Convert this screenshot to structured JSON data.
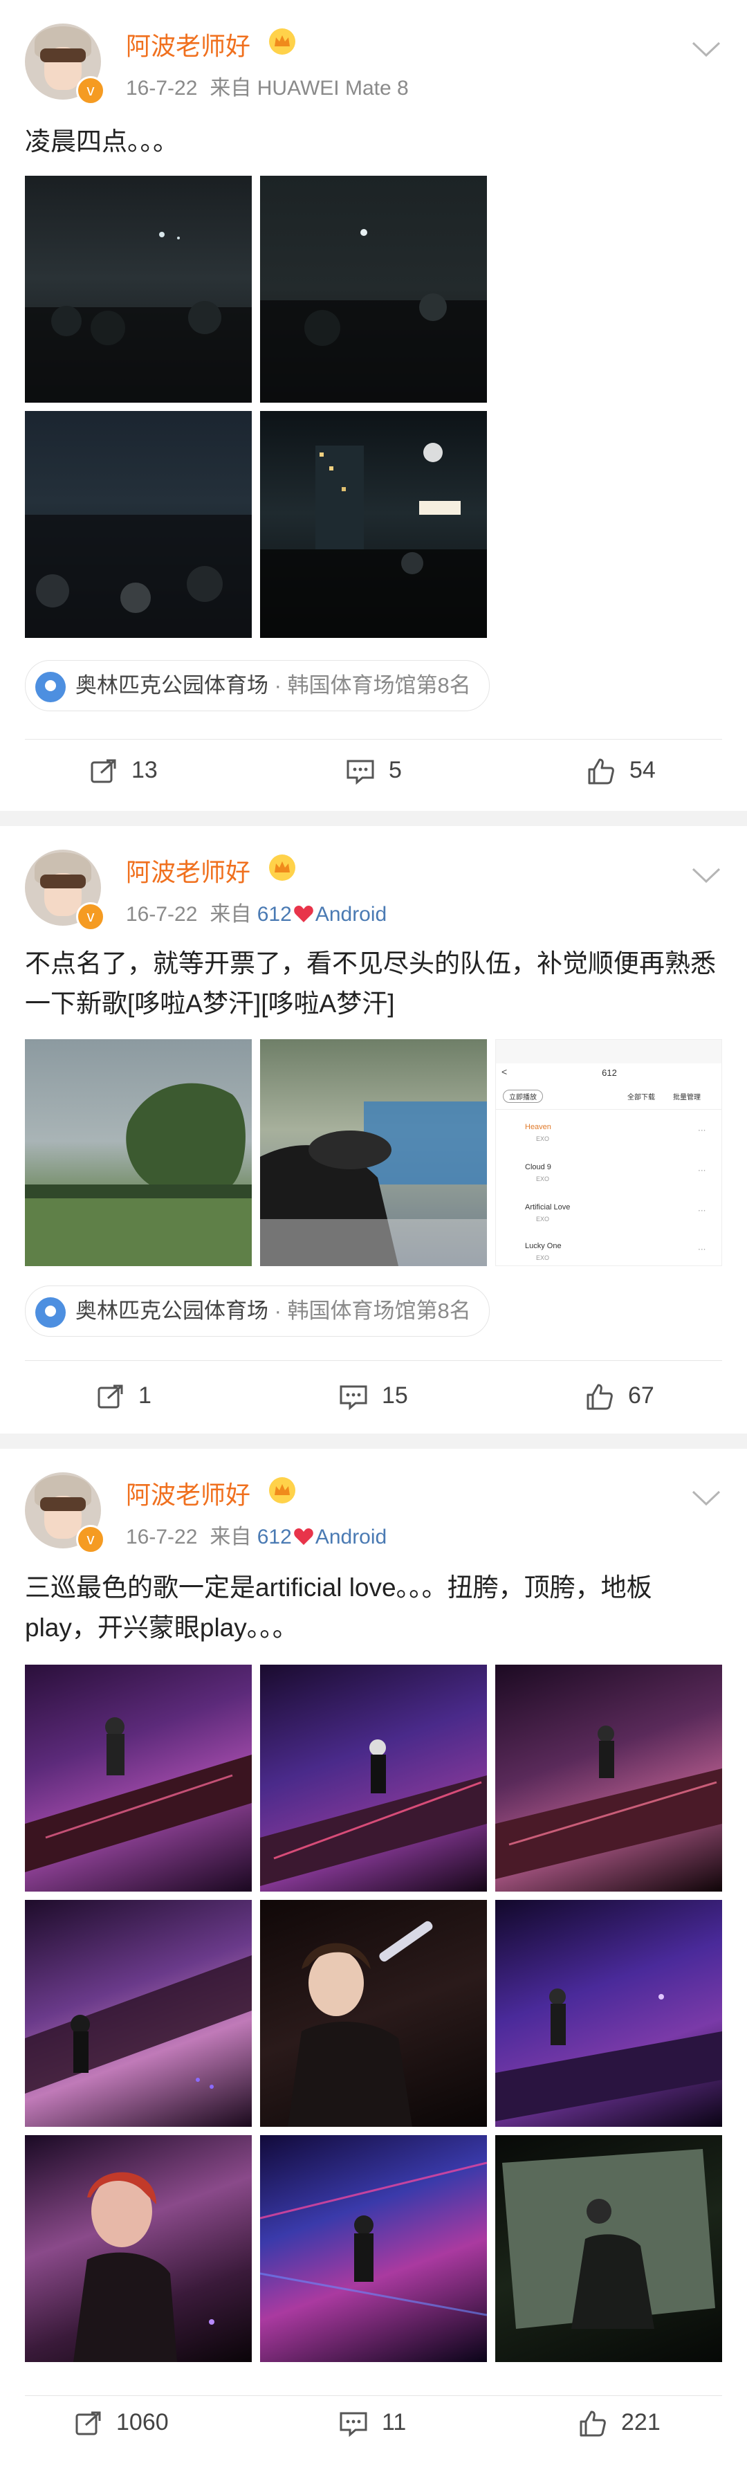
{
  "posts": [
    {
      "username": "阿波老师好",
      "date": "16-7-22",
      "source_prefix": "来自",
      "source_client": "HUAWEI Mate 8",
      "text": "凌晨四点。。。",
      "location_name": "奥林匹克公园体育场",
      "location_detail": "· 韩国体育场馆第8名",
      "repost_count": "13",
      "comment_count": "5",
      "like_count": "54"
    },
    {
      "username": "阿波老师好",
      "date": "16-7-22",
      "source_prefix": "来自",
      "source_client_a": "612",
      "source_client_b": "Android",
      "text": "不点名了，就等开票了，看不见尽头的队伍，补觉顺便再熟悉一下新歌[哆啦A梦汗][哆啦A梦汗]",
      "location_name": "奥林匹克公园体育场",
      "location_detail": "· 韩国体育场馆第8名",
      "repost_count": "1",
      "comment_count": "15",
      "like_count": "67",
      "screenshot": {
        "header_title": "612",
        "play_all": "立即播放",
        "download_all": "全部下载",
        "batch": "批量管理",
        "songs": [
          {
            "title": "Heaven",
            "artist": "EXO"
          },
          {
            "title": "Cloud 9",
            "artist": "EXO"
          },
          {
            "title": "Artificial Love",
            "artist": "EXO"
          },
          {
            "title": "Lucky One",
            "artist": "EXO"
          }
        ]
      }
    },
    {
      "username": "阿波老师好",
      "date": "16-7-22",
      "source_prefix": "来自",
      "source_client_a": "612",
      "source_client_b": "Android",
      "text": "三巡最色的歌一定是artificial love。。。扭胯，顶胯，地板play，开兴蒙眼play。。。",
      "repost_count": "1060",
      "comment_count": "11",
      "like_count": "221"
    }
  ],
  "colors": {
    "username": "#f0701e",
    "client_link": "#4a7ab3",
    "meta_gray": "#8a8a8a",
    "background": "#f2f2f2"
  }
}
